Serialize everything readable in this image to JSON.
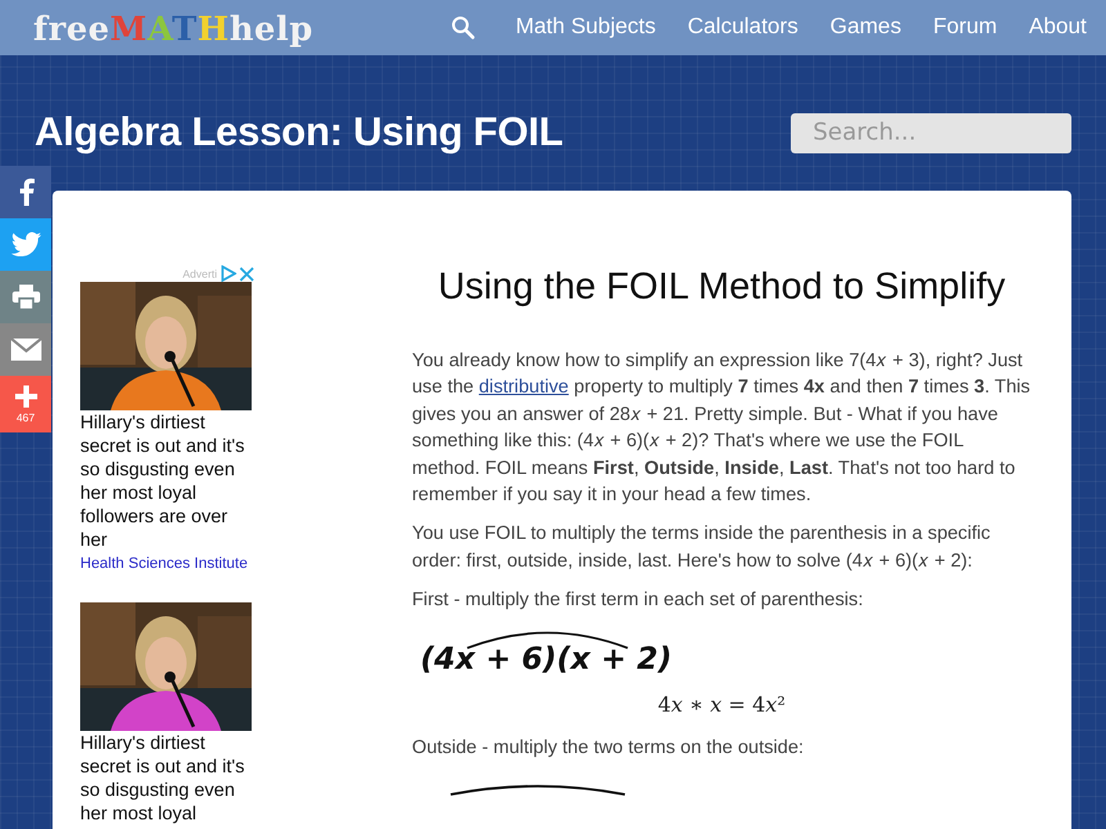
{
  "header": {
    "logo": [
      {
        "text": "free",
        "color": "#f2f2f2"
      },
      {
        "text": "M",
        "color": "#e0443a"
      },
      {
        "text": "A",
        "color": "#8cc63e"
      },
      {
        "text": "T",
        "color": "#2b5fa8"
      },
      {
        "text": "H",
        "color": "#f2d12e"
      },
      {
        "text": "help",
        "color": "#f2f2f2"
      }
    ],
    "nav": [
      {
        "label": "Math Subjects"
      },
      {
        "label": "Calculators"
      },
      {
        "label": "Games"
      },
      {
        "label": "Forum"
      },
      {
        "label": "About"
      }
    ]
  },
  "page_title": "Algebra Lesson: Using FOIL",
  "search": {
    "placeholder": "Search..."
  },
  "share": [
    {
      "kind": "facebook"
    },
    {
      "kind": "twitter"
    },
    {
      "kind": "print"
    },
    {
      "kind": "email"
    },
    {
      "kind": "more",
      "count": "467"
    }
  ],
  "ads": {
    "label": "Adverti",
    "items": [
      {
        "kind": "picture",
        "headline": "Hillary's dirtiest secret is out and it's so disgusting even her most loyal followers are over her",
        "source": "Health Sciences Institute"
      },
      {
        "kind": "picture",
        "headline": "Hillary's dirtiest secret is out and it's so disgusting even her most loyal"
      }
    ]
  },
  "article": {
    "heading": "Using the FOIL Method to Simplify",
    "blocks": [
      {
        "kind": "paragraph",
        "before": "You already know how to simplify an expression like 7(4𝑥 + 3), right? Just use the",
        "link": "distributive",
        "after": "property to multiply **7** times **4x** and then **7** times **3**. This gives you an answer of 28𝑥 + 21. Pretty simple. But - What if you have something like this: (4𝑥 + 6)(𝑥 + 2)? That's where we use the FOIL method. FOIL means **First**, **Outside**, **Inside**, **Last**. That's not too hard to remember if you say it in your head a few times."
      },
      {
        "kind": "paragraph",
        "before": "You use FOIL to multiply the terms inside the parenthesis in a specific order: first, outside, inside, last. Here's how to solve (4𝑥 + 6)(𝑥 + 2):"
      },
      {
        "kind": "paragraph",
        "before": "First - multiply the first term in each set of parenthesis:"
      },
      {
        "kind": "handwritten",
        "text": "(4x + 6)(x + 2)"
      },
      {
        "kind": "equation",
        "text": "4𝑥 ∗ 𝑥 = 4𝑥²"
      },
      {
        "kind": "paragraph",
        "before": "Outside - multiply the two terms on the outside:"
      },
      {
        "kind": "arc"
      }
    ]
  }
}
